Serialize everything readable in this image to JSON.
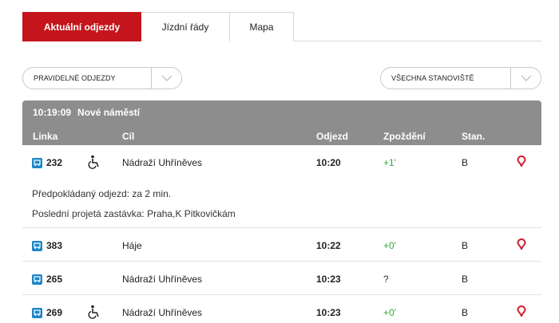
{
  "tabs": [
    {
      "label": "Aktuální odjezdy",
      "active": true
    },
    {
      "label": "Jízdní řády",
      "active": false
    },
    {
      "label": "Mapa",
      "active": false
    }
  ],
  "filters": {
    "departures": "PRAVIDELNÉ ODJEZDY",
    "stands": "VŠECHNA STANOVIŠTĚ"
  },
  "board": {
    "time": "10:19:09",
    "station": "Nové náměstí",
    "columns": {
      "line": "Linka",
      "destination": "Cíl",
      "departure": "Odjezd",
      "delay": "Zpoždění",
      "stand": "Stan."
    },
    "rows": [
      {
        "line": "232",
        "accessible": true,
        "destination": "Nádraží Uhříněves",
        "departure": "10:20",
        "delay": "+1'",
        "stand": "B",
        "location": true,
        "expected": "Předpokládaný odjezd: za 2 min.",
        "last_stop": "Poslední projetá zastávka: Praha,K Pitkovičkám"
      },
      {
        "line": "383",
        "accessible": false,
        "destination": "Háje",
        "departure": "10:22",
        "delay": "+0'",
        "stand": "B",
        "location": true
      },
      {
        "line": "265",
        "accessible": false,
        "destination": "Nádraží Uhříněves",
        "departure": "10:23",
        "delay": "?",
        "stand": "B",
        "location": false
      },
      {
        "line": "269",
        "accessible": true,
        "destination": "Nádraží Uhříněves",
        "departure": "10:23",
        "delay": "+0'",
        "stand": "B",
        "location": true
      }
    ]
  },
  "colors": {
    "accent": "#c4151c",
    "header": "#8d8d8d",
    "bus_icon": "#1f86c8",
    "delay_ok": "#35a835"
  }
}
